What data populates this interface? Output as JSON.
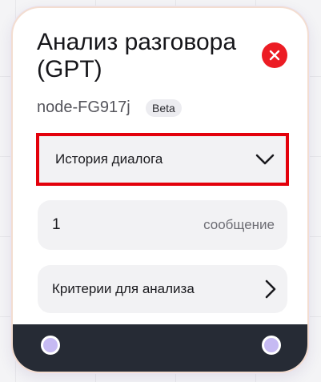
{
  "node": {
    "title": "Анализ разговора (GPT)",
    "id_label": "node-FG917j",
    "badge": "Beta",
    "close_icon": "close-icon",
    "dropdown": {
      "label": "История диалога",
      "icon": "chevron-down-icon"
    },
    "messages": {
      "value": "1",
      "unit": "сообщение"
    },
    "criteria": {
      "label": "Критерии для анализа",
      "icon": "chevron-right-icon"
    },
    "ports": [
      "input-port",
      "output-port"
    ]
  },
  "colors": {
    "accent_red": "#ec1c24",
    "highlight_border": "#e3000b",
    "footer": "#262b35",
    "port_fill": "#c6baf3",
    "field_bg": "#f2f2f4"
  }
}
